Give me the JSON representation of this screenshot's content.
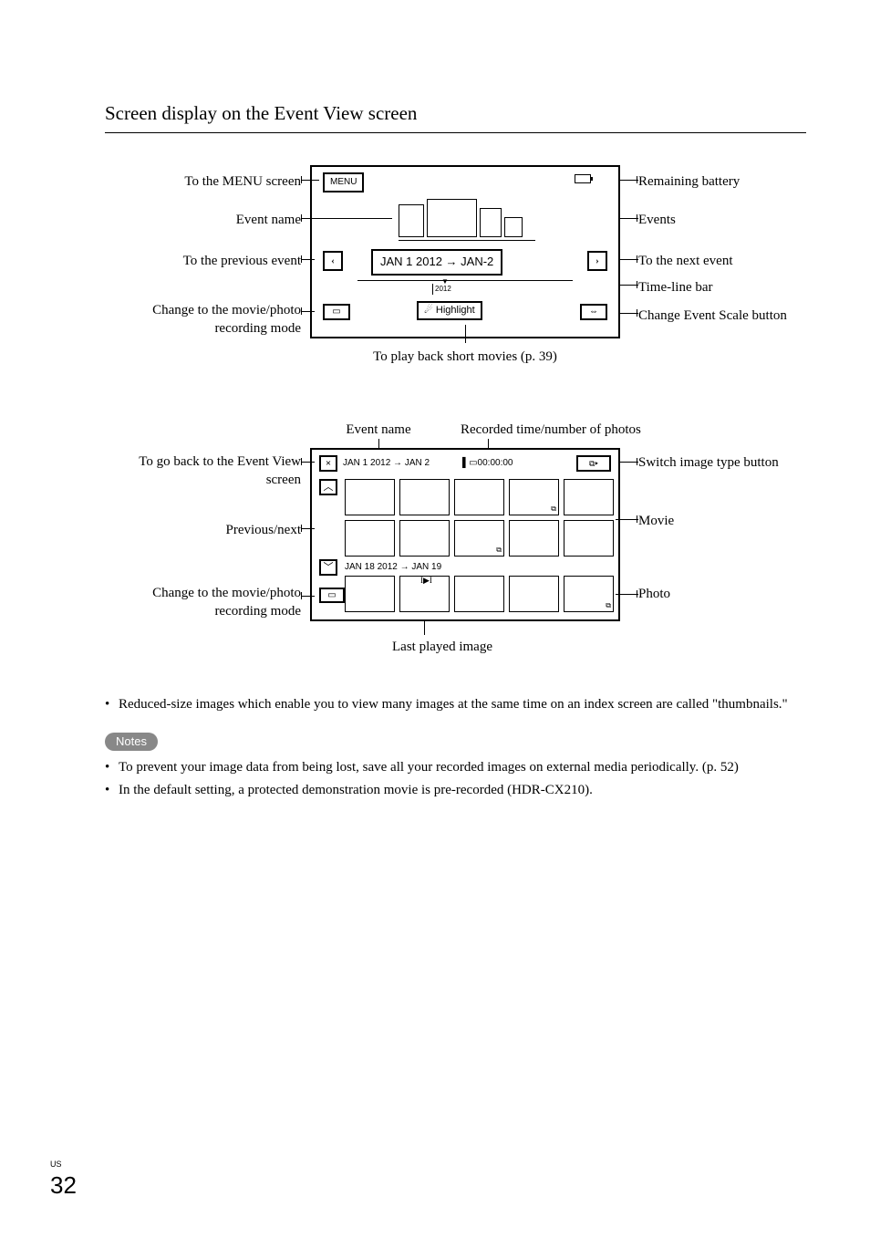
{
  "section_title": "Screen display on the Event View screen",
  "event_view": {
    "labels": {
      "menu": "To the MENU screen",
      "event_name": "Event name",
      "prev_event": "To the previous event",
      "rec_mode": "Change to the  movie/photo recording mode",
      "battery": "Remaining battery",
      "events": "Events",
      "next_event": "To the next event",
      "timeline": "Time-line bar",
      "scale": "Change Event Scale button",
      "playback_caption": "To play back short movies (p. 39)"
    },
    "ui": {
      "menu_btn": "MENU",
      "date_box": "JAN 1 2012 → JAN-2",
      "year": "2012",
      "highlight_btn": "Highlight",
      "prev_glyph": "‹",
      "next_glyph": "›"
    }
  },
  "event_index": {
    "labels": {
      "event_name": "Event name",
      "recorded": "Recorded time/number of photos",
      "back": "To go back to the Event View screen",
      "prev_next": "Previous/next",
      "rec_mode": "Change to the movie/photo recording mode",
      "switch": "Switch image type button",
      "movie": "Movie",
      "photo": "Photo",
      "last_played": "Last played image"
    },
    "ui": {
      "close_glyph": "×",
      "date": "JAN 1 2012 → JAN 2",
      "time": "00:00:00",
      "up_glyph": "︿",
      "down_glyph": "﹀",
      "sub_date": "JAN 18 2012 → JAN 19",
      "play_glyph": "I▶I"
    }
  },
  "thumbnails_para": "Reduced-size images which enable you to view many images at the same time on an index screen are called \"thumbnails.\"",
  "notes_label": "Notes",
  "notes": [
    "To prevent your image data from being lost, save all your recorded images on external media periodically. (p.  52)",
    "In the default setting, a protected demonstration movie is pre-recorded (HDR-CX210)."
  ],
  "page": {
    "region": "US",
    "number": "32"
  }
}
